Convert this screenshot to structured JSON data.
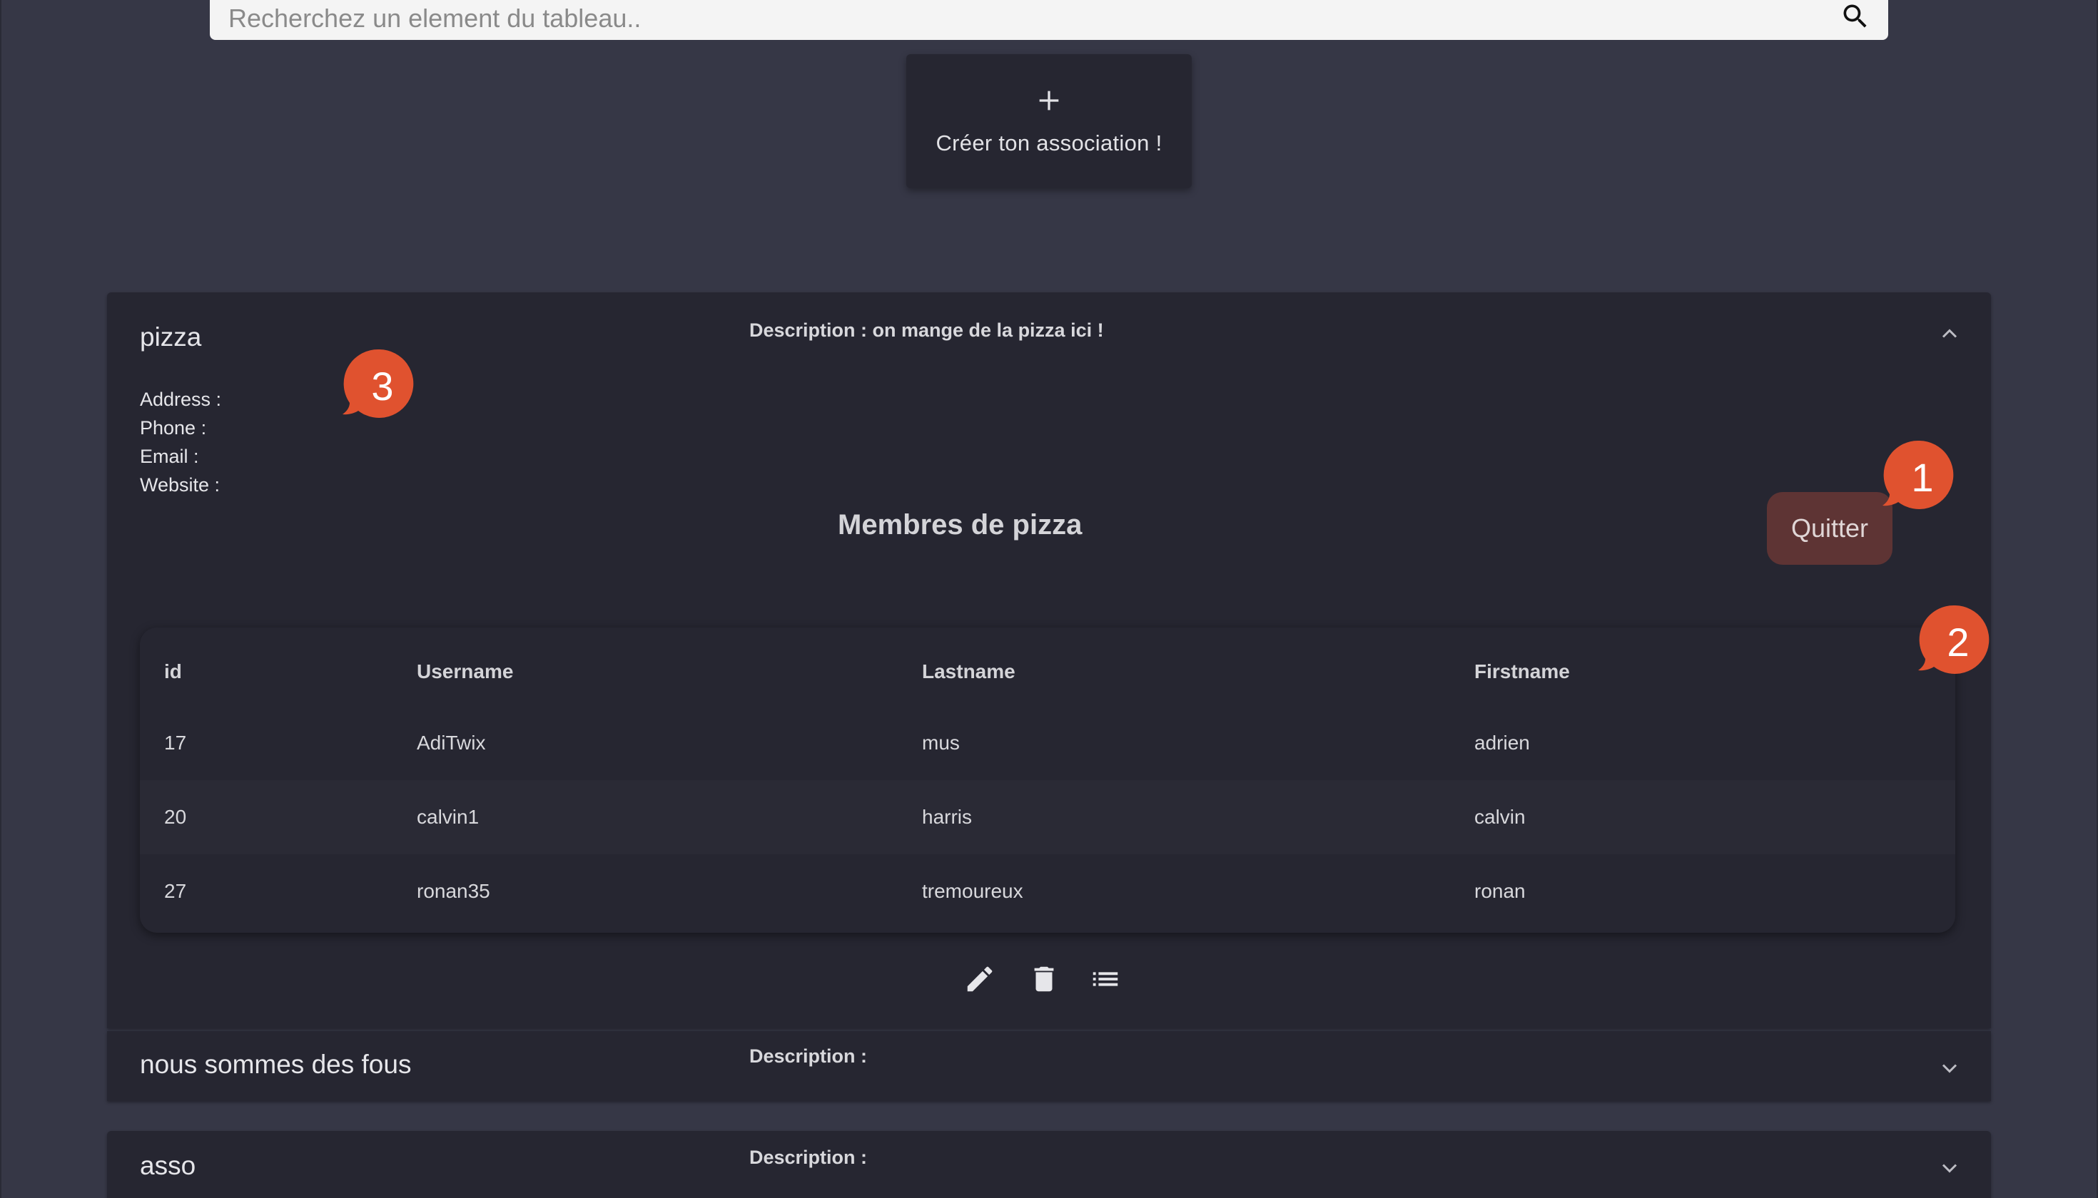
{
  "search": {
    "placeholder": "Recherchez un element du tableau.."
  },
  "create_card": {
    "label": "Créer ton association !"
  },
  "associations": [
    {
      "name": "pizza",
      "description": "Description : on mange de la pizza ici !",
      "expanded": true,
      "info": {
        "address": "Address :",
        "phone": "Phone :",
        "email": "Email :",
        "website": "Website :"
      },
      "members_title": "Membres de pizza",
      "quit_label": "Quitter",
      "table": {
        "headers": [
          "id",
          "Username",
          "Lastname",
          "Firstname"
        ],
        "rows": [
          [
            "17",
            "AdiTwix",
            "mus",
            "adrien"
          ],
          [
            "20",
            "calvin1",
            "harris",
            "calvin"
          ],
          [
            "27",
            "ronan35",
            "tremoureux",
            "ronan"
          ]
        ]
      },
      "actions": [
        "edit-icon",
        "delete-icon",
        "list-icon"
      ]
    },
    {
      "name": "nous sommes des fous",
      "description": "Description :",
      "expanded": false
    },
    {
      "name": "asso",
      "description": "Description :",
      "expanded": false
    }
  ],
  "callouts": [
    "1",
    "2",
    "3"
  ],
  "colors": {
    "background": "#363746",
    "panel": "#262631",
    "quit_button": "#5e3434",
    "callout": "#e0522f"
  }
}
